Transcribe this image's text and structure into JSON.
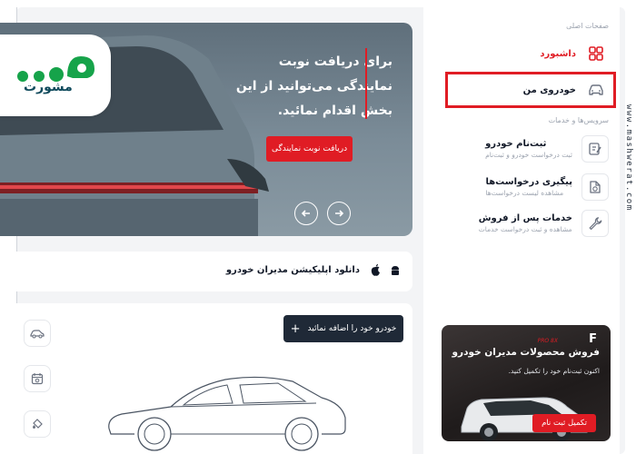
{
  "sidebar": {
    "main_pages_heading": "صفحات اصلی",
    "nav": [
      {
        "label": "داشبورد",
        "icon": "grid-icon"
      },
      {
        "label": "خودروی من",
        "icon": "car-icon"
      }
    ],
    "services_heading": "سرویس‌ها و خدمات",
    "services": [
      {
        "title": "ثبت‌نام خودرو",
        "subtitle": "ثبت درخواست خودرو و ثبت‌نام",
        "icon": "edit-document-icon"
      },
      {
        "title": "پیگیری درخواست‌ها",
        "subtitle": "مشاهده لیست درخواست‌ها",
        "icon": "file-refresh-icon"
      },
      {
        "title": "خدمات پس از فروش",
        "subtitle": "مشاهده و ثبت درخواست خدمات",
        "icon": "wrench-icon"
      }
    ],
    "promo": {
      "brand": "F",
      "brand_sub": "PRO 8X",
      "title": "فروش محصولات مدیران خودرو",
      "description": "اکنون ثبت‌نام خود را تکمیل کنید.",
      "button": "تکمیل ثبت نام"
    }
  },
  "hero": {
    "text": "برای دریافت نوبت نمایندگی می‌توانید از این بخش اقدام نمائید.",
    "button": "دریافت نوبت نمایندگی"
  },
  "app_download": {
    "label": "دانلود اپلیکیشن مدیران خودرو"
  },
  "my_car": {
    "add_button": "خودرو خود را اضافه نمائید"
  },
  "logo": {
    "text": "مشورت"
  },
  "watermark": "www.mashwerat.com",
  "colors": {
    "accent": "#e01c24",
    "highlight": "#e01c24",
    "dark": "#1f2937"
  }
}
